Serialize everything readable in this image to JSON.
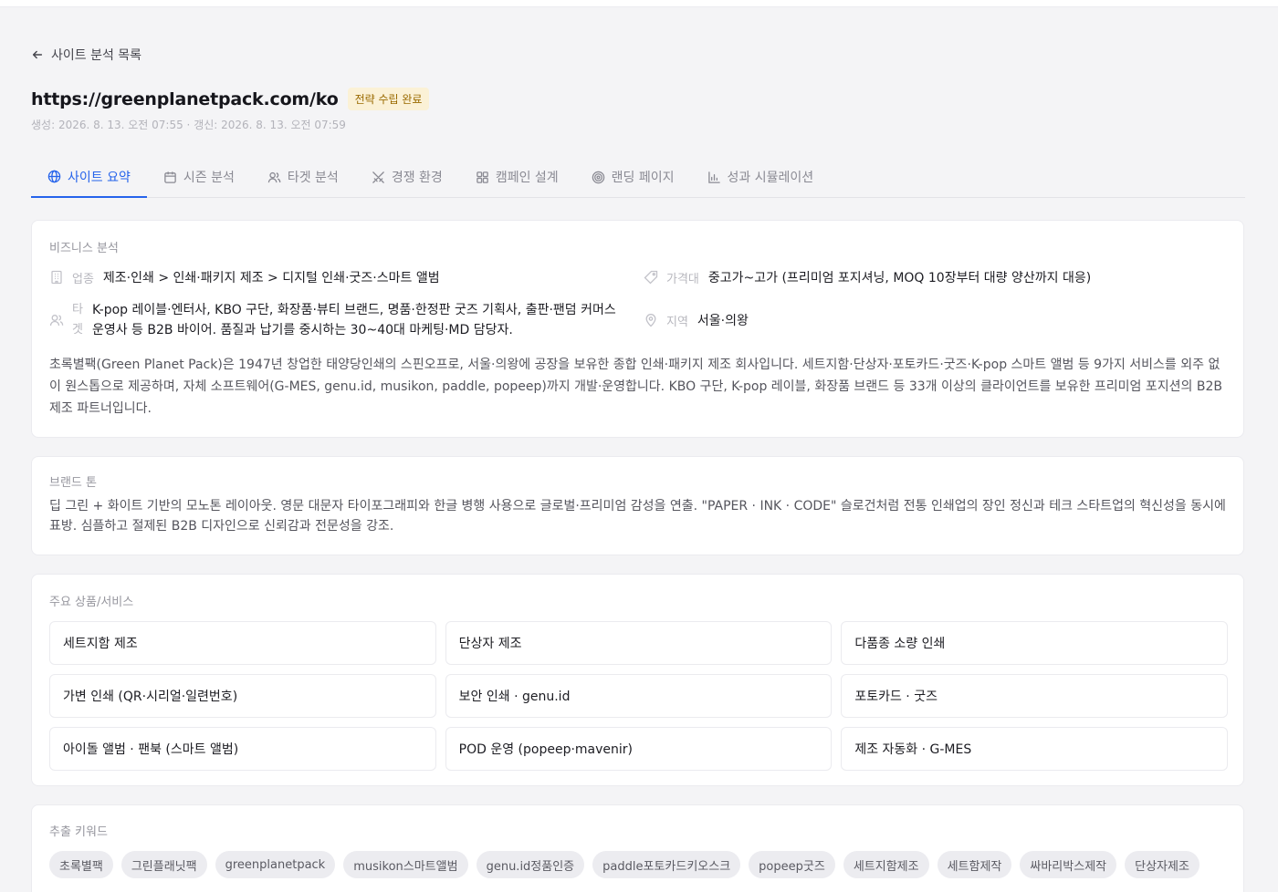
{
  "nav": {
    "back_label": "사이트 분석 목록"
  },
  "header": {
    "url": "https://greenplanetpack.com/ko",
    "status_badge": "전략 수립 완료",
    "meta": "생성: 2026. 8. 13. 오전 07:55 · 갱신: 2026. 8. 13. 오전 07:59"
  },
  "tabs": [
    {
      "label": "사이트 요약",
      "icon": "globe-icon"
    },
    {
      "label": "시즌 분석",
      "icon": "calendar-icon"
    },
    {
      "label": "타겟 분석",
      "icon": "users-icon"
    },
    {
      "label": "경쟁 환경",
      "icon": "swords-icon"
    },
    {
      "label": "캠페인 설계",
      "icon": "grid-icon"
    },
    {
      "label": "랜딩 페이지",
      "icon": "target-icon"
    },
    {
      "label": "성과 시뮬레이션",
      "icon": "chart-icon"
    }
  ],
  "business": {
    "title": "비즈니스 분석",
    "industry_label": "업종",
    "industry": "제조·인쇄 > 인쇄·패키지 제조 > 디지털 인쇄·굿즈·스마트 앨범",
    "price_label": "가격대",
    "price": "중고가~고가 (프리미엄 포지셔닝, MOQ 10장부터 대량 양산까지 대응)",
    "target_label_1": "타",
    "target_label_2": "겟",
    "target": "K-pop 레이블·엔터사, KBO 구단, 화장품·뷰티 브랜드, 명품·한정판 굿즈 기획사, 출판·팬덤 커머스 운영사 등 B2B 바이어. 품질과 납기를 중시하는 30~40대 마케팅·MD 담당자.",
    "region_label": "지역",
    "region": "서울·의왕",
    "description": "초록별팩(Green Planet Pack)은 1947년 창업한 태양당인쇄의 스핀오프로, 서울·의왕에 공장을 보유한 종합 인쇄·패키지 제조 회사입니다. 세트지함·단상자·포토카드·굿즈·K-pop 스마트 앨범 등 9가지 서비스를 외주 없이 원스톱으로 제공하며, 자체 소프트웨어(G-MES, genu.id, musikon, paddle, popeep)까지 개발·운영합니다. KBO 구단, K-pop 레이블, 화장품 브랜드 등 33개 이상의 클라이언트를 보유한 프리미엄 포지션의 B2B 제조 파트너입니다."
  },
  "brand_tone": {
    "title": "브랜드 톤",
    "text": "딥 그린 + 화이트 기반의 모노톤 레이아웃. 영문 대문자 타이포그래피와 한글 병행 사용으로 글로벌·프리미엄 감성을 연출. \"PAPER · INK · CODE\" 슬로건처럼 전통 인쇄업의 장인 정신과 테크 스타트업의 혁신성을 동시에 표방. 심플하고 절제된 B2B 디자인으로 신뢰감과 전문성을 강조."
  },
  "products": {
    "title": "주요 상품/서비스",
    "items": [
      "세트지함 제조",
      "단상자 제조",
      "다품종 소량 인쇄",
      "가변 인쇄 (QR·시리얼·일련번호)",
      "보안 인쇄 · genu.id",
      "포토카드 · 굿즈",
      "아이돌 앨범 · 팬북 (스마트 앨범)",
      "POD 운영 (popeep·mavenir)",
      "제조 자동화 · G-MES"
    ]
  },
  "keywords": {
    "title": "추출 키워드",
    "items": [
      "초록별팩",
      "그린플래닛팩",
      "greenplanetpack",
      "musikon스마트앨범",
      "genu.id정품인증",
      "paddle포토카드키오스크",
      "popeep굿즈",
      "세트지함제조",
      "세트함제작",
      "싸바리박스제작",
      "단상자제조"
    ]
  },
  "colors": {
    "accent": "#2563eb",
    "badge_bg": "#fbf1d6",
    "badge_text": "#9a6a00"
  }
}
